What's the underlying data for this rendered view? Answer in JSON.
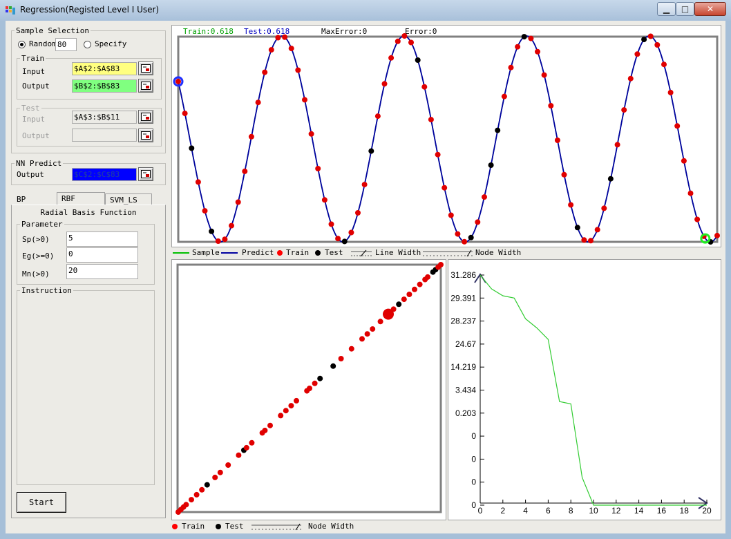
{
  "window": {
    "title": "Regression(Registed Level I User)",
    "minimize_glyph": "▁",
    "maximize_glyph": "□",
    "close_glyph": "✕"
  },
  "sample_selection": {
    "legend": "Sample Selection",
    "random_label": "Random",
    "random_value": "80",
    "specify_label": "Specify",
    "selected": "random"
  },
  "train": {
    "legend": "Train",
    "input_label": "Input",
    "input_value": "$A$2:$A$83",
    "output_label": "Output",
    "output_value": "$B$2:$B$83",
    "input_color": "#ffff80",
    "output_color": "#80ff80"
  },
  "test": {
    "legend": "Test",
    "input_label": "Input",
    "input_value": "$A$3:$B$11",
    "output_label": "Output",
    "output_value": ""
  },
  "nn_predict": {
    "legend": "NN Predict",
    "output_label": "Output",
    "output_value": "$C$2:$C$83",
    "output_color": "#0000ff"
  },
  "tabs": [
    {
      "label": "BP",
      "active": false
    },
    {
      "label": "RBF",
      "active": true
    },
    {
      "label": "SVM_LS",
      "active": false
    }
  ],
  "rbf": {
    "title": "Radial Basis Function",
    "parameter_legend": "Parameter",
    "sp_label": "Sp(>0)",
    "sp_value": "5",
    "eg_label": "Eg(>=0)",
    "eg_value": "0",
    "mn_label": "Mn(>0)",
    "mn_value": "20",
    "instruction_legend": "Instruction",
    "start_label": "Start"
  },
  "top_chart": {
    "train_stat": "Train:0.618",
    "test_stat": "Test:0.618",
    "max_error": "MaxError:0",
    "error": "Error:0",
    "train_stat_color": "#00a000",
    "test_stat_color": "#0000c0",
    "legend": {
      "sample": "Sample",
      "predict": "Predict",
      "train": "Train",
      "test": "Test",
      "line_width": "Line Width",
      "node_width": "Node Width"
    }
  },
  "bottom_left_legend": {
    "train": "Train",
    "test": "Test",
    "node_width": "Node Width"
  },
  "chart_data": [
    {
      "type": "line",
      "description_source": "top regression chart",
      "series": [
        {
          "name": "Sample",
          "color": "#00c000"
        },
        {
          "name": "Predict",
          "color": "#0000a0"
        },
        {
          "name": "Train",
          "color": "#ff0000"
        },
        {
          "name": "Test",
          "color": "#000000"
        }
      ],
      "cycles": 4.4,
      "point_count": 82,
      "test_indices": [
        2,
        5,
        25,
        29,
        36,
        44,
        47,
        48,
        52,
        60,
        65,
        70,
        80
      ]
    },
    {
      "type": "scatter",
      "description_source": "bottom-left predicted vs actual",
      "series": [
        {
          "name": "Train",
          "color": "#ff0000"
        },
        {
          "name": "Test",
          "color": "#000000"
        }
      ]
    },
    {
      "type": "line",
      "description_source": "bottom-right training error curve",
      "color": "#33cc33",
      "x_ticks": [
        "0",
        "2",
        "4",
        "6",
        "8",
        "10",
        "12",
        "14",
        "16",
        "18",
        "20"
      ],
      "y_ticks": [
        "31.286",
        "29.391",
        "28.237",
        "24.67",
        "14.219",
        "3.434",
        "0.203",
        "0",
        "0",
        "0",
        "0"
      ],
      "x": [
        0,
        1,
        2,
        3,
        4,
        5,
        6,
        7,
        8,
        9,
        10,
        11,
        12,
        13,
        14,
        15,
        16,
        17,
        18,
        19,
        20
      ],
      "y_rank": [
        0,
        0.6,
        0.9,
        1.0,
        1.9,
        2.3,
        2.8,
        5.5,
        5.6,
        8.8,
        10.0,
        10.0,
        10.0,
        10.0,
        10.0,
        10.0,
        10.0,
        10.0,
        10.0,
        10.0,
        10.0
      ]
    }
  ]
}
